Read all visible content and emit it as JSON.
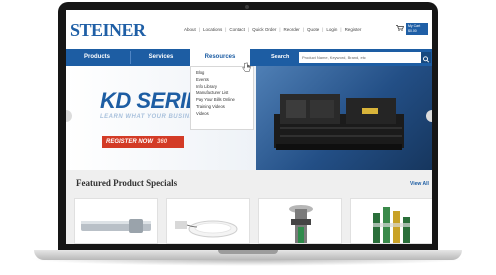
{
  "site": {
    "logo": "STEINER",
    "top_links": [
      "About",
      "Locations",
      "Contact",
      "Quick Order",
      "Reorder",
      "Quote",
      "Login",
      "Register"
    ],
    "cart": {
      "line1": "My Cart",
      "line2": "$0.00"
    }
  },
  "nav": {
    "products": "Products",
    "services": "Services",
    "resources": "Resources",
    "search_label": "Search",
    "search_placeholder": "Product Name, Keyword, Brand, etc"
  },
  "resources_menu": [
    "Blog",
    "Events",
    "Info Library",
    "Manufacturer List",
    "Pay Your Bills Online",
    "Training Videos",
    "Videos"
  ],
  "hero": {
    "title": "KD SERIES",
    "subtitle": "LEARN WHAT YOUR BUSINESS NEEDS",
    "button": "REGISTER NOW",
    "button_num": "360"
  },
  "featured": {
    "title": "Featured Product Specials",
    "view_all": "View All"
  },
  "colors": {
    "brand_blue": "#1d5da3",
    "cta_red": "#d33b26"
  }
}
